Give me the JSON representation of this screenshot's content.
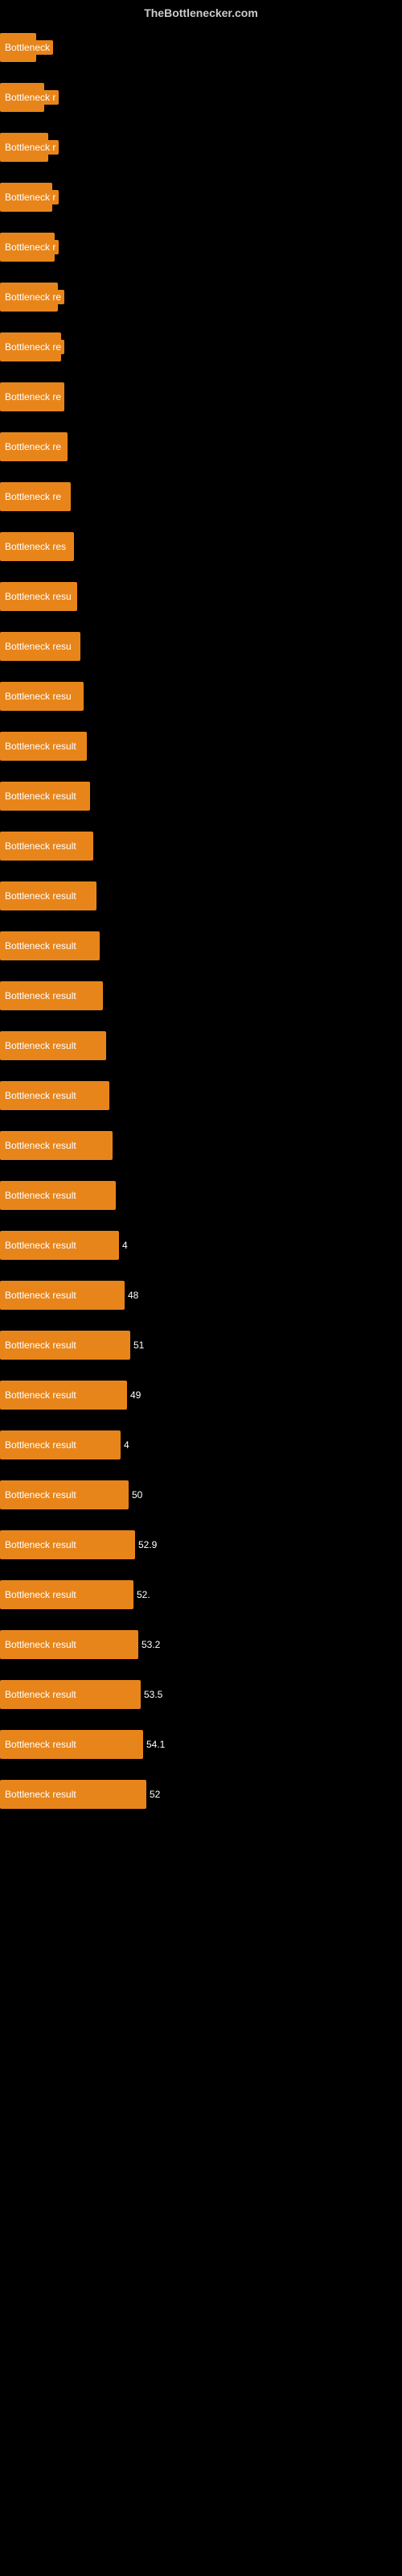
{
  "header": {
    "title": "TheBottlenecker.com"
  },
  "bars": [
    {
      "label": "Bottleneck",
      "width": 45,
      "value": ""
    },
    {
      "label": "Bottleneck r",
      "width": 55,
      "value": ""
    },
    {
      "label": "Bottleneck r",
      "width": 60,
      "value": ""
    },
    {
      "label": "Bottleneck r",
      "width": 65,
      "value": ""
    },
    {
      "label": "Bottleneck r",
      "width": 68,
      "value": ""
    },
    {
      "label": "Bottleneck re",
      "width": 72,
      "value": ""
    },
    {
      "label": "Bottleneck re",
      "width": 76,
      "value": ""
    },
    {
      "label": "Bottleneck re",
      "width": 80,
      "value": ""
    },
    {
      "label": "Bottleneck re",
      "width": 84,
      "value": ""
    },
    {
      "label": "Bottleneck re",
      "width": 88,
      "value": ""
    },
    {
      "label": "Bottleneck res",
      "width": 92,
      "value": ""
    },
    {
      "label": "Bottleneck resu",
      "width": 96,
      "value": ""
    },
    {
      "label": "Bottleneck resu",
      "width": 100,
      "value": ""
    },
    {
      "label": "Bottleneck resu",
      "width": 104,
      "value": ""
    },
    {
      "label": "Bottleneck result",
      "width": 108,
      "value": ""
    },
    {
      "label": "Bottleneck result",
      "width": 112,
      "value": ""
    },
    {
      "label": "Bottleneck result",
      "width": 116,
      "value": ""
    },
    {
      "label": "Bottleneck result",
      "width": 120,
      "value": ""
    },
    {
      "label": "Bottleneck result",
      "width": 124,
      "value": ""
    },
    {
      "label": "Bottleneck result",
      "width": 128,
      "value": ""
    },
    {
      "label": "Bottleneck result",
      "width": 132,
      "value": ""
    },
    {
      "label": "Bottleneck result",
      "width": 136,
      "value": ""
    },
    {
      "label": "Bottleneck result",
      "width": 140,
      "value": ""
    },
    {
      "label": "Bottleneck result",
      "width": 144,
      "value": ""
    },
    {
      "label": "Bottleneck result",
      "width": 148,
      "value": "4"
    },
    {
      "label": "Bottleneck result",
      "width": 155,
      "value": "48"
    },
    {
      "label": "Bottleneck result",
      "width": 162,
      "value": "51"
    },
    {
      "label": "Bottleneck result",
      "width": 158,
      "value": "49"
    },
    {
      "label": "Bottleneck result",
      "width": 150,
      "value": "4"
    },
    {
      "label": "Bottleneck result",
      "width": 160,
      "value": "50"
    },
    {
      "label": "Bottleneck result",
      "width": 168,
      "value": "52.9"
    },
    {
      "label": "Bottleneck result",
      "width": 166,
      "value": "52."
    },
    {
      "label": "Bottleneck result",
      "width": 172,
      "value": "53.2"
    },
    {
      "label": "Bottleneck result",
      "width": 175,
      "value": "53.5"
    },
    {
      "label": "Bottleneck result",
      "width": 178,
      "value": "54.1"
    },
    {
      "label": "Bottleneck result",
      "width": 182,
      "value": "52"
    }
  ]
}
